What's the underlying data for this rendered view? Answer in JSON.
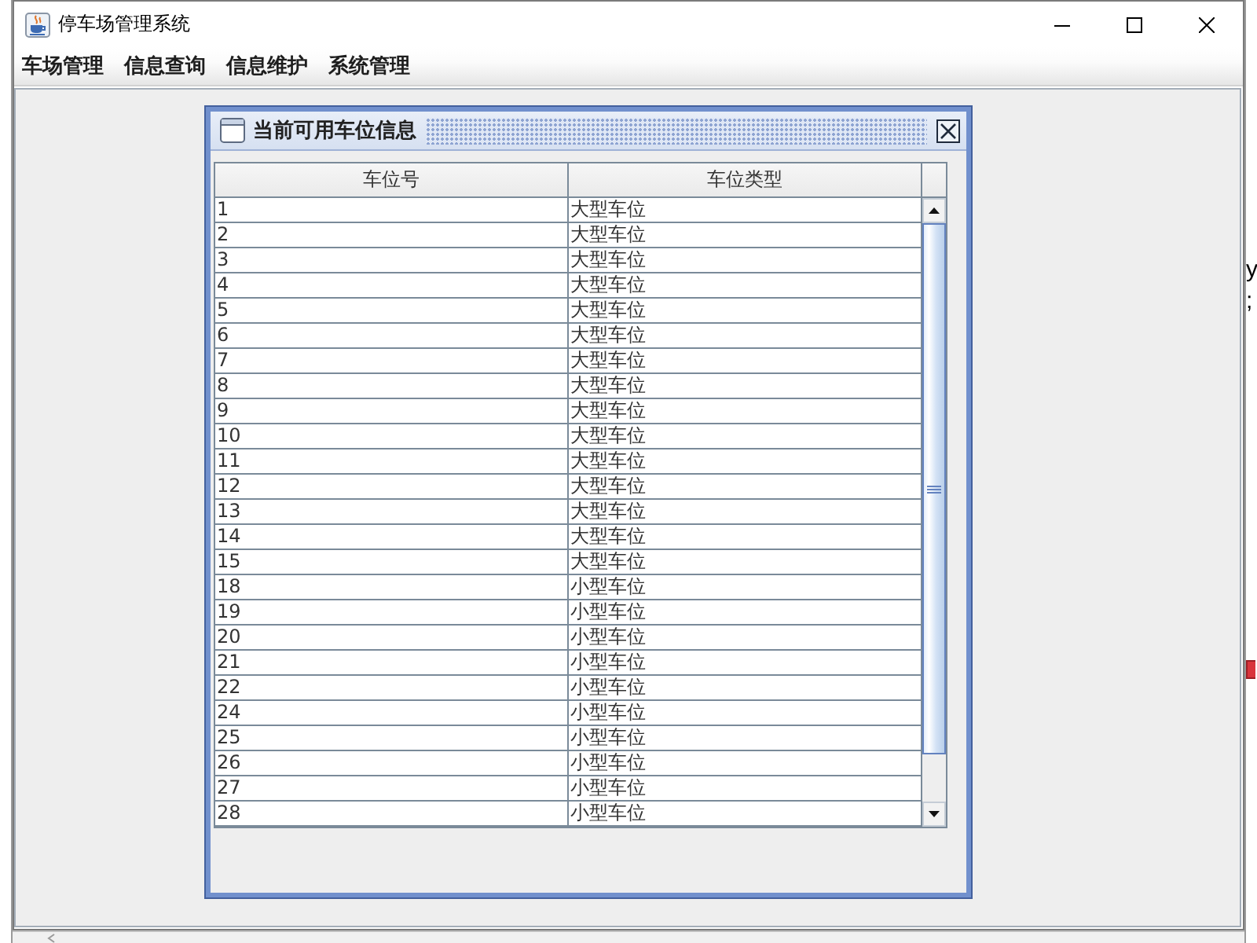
{
  "window": {
    "title": "停车场管理系统"
  },
  "menu_bar": [
    "车场管理",
    "信息查询",
    "信息维护",
    "系统管理"
  ],
  "internal_window": {
    "title": "当前可用车位信息",
    "table": {
      "columns": [
        "车位号",
        "车位类型"
      ],
      "rows": [
        [
          "1",
          "大型车位"
        ],
        [
          "2",
          "大型车位"
        ],
        [
          "3",
          "大型车位"
        ],
        [
          "4",
          "大型车位"
        ],
        [
          "5",
          "大型车位"
        ],
        [
          "6",
          "大型车位"
        ],
        [
          "7",
          "大型车位"
        ],
        [
          "8",
          "大型车位"
        ],
        [
          "9",
          "大型车位"
        ],
        [
          "10",
          "大型车位"
        ],
        [
          "11",
          "大型车位"
        ],
        [
          "12",
          "大型车位"
        ],
        [
          "13",
          "大型车位"
        ],
        [
          "14",
          "大型车位"
        ],
        [
          "15",
          "大型车位"
        ],
        [
          "18",
          "小型车位"
        ],
        [
          "19",
          "小型车位"
        ],
        [
          "20",
          "小型车位"
        ],
        [
          "21",
          "小型车位"
        ],
        [
          "22",
          "小型车位"
        ],
        [
          "24",
          "小型车位"
        ],
        [
          "25",
          "小型车位"
        ],
        [
          "26",
          "小型车位"
        ],
        [
          "27",
          "小型车位"
        ],
        [
          "28",
          "小型车位"
        ]
      ]
    }
  },
  "background_window": {
    "text_lines": [
      "y",
      ";"
    ]
  }
}
